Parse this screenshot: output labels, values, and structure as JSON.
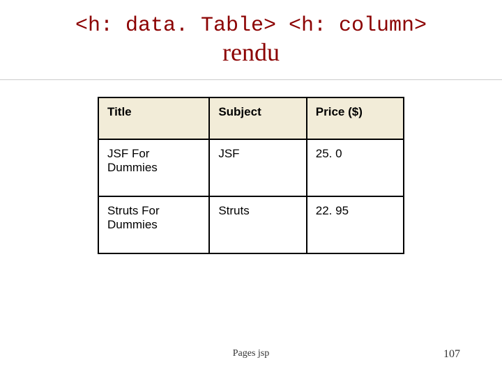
{
  "title": {
    "code_left": "<h: data. Table>",
    "code_right": " <h: column>",
    "word": "rendu"
  },
  "chart_data": {
    "type": "table",
    "columns": [
      "Title",
      "Subject",
      "Price ($)"
    ],
    "rows": [
      {
        "title": "JSF For Dummies",
        "subject": "JSF",
        "price": "25. 0"
      },
      {
        "title": "Struts For Dummies",
        "subject": "Struts",
        "price": "22. 95"
      }
    ]
  },
  "footer": {
    "center": "Pages jsp",
    "page_number": "107"
  }
}
